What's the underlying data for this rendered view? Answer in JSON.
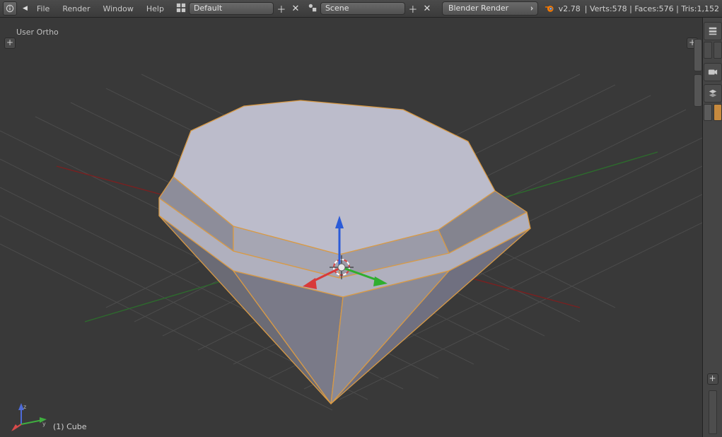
{
  "header": {
    "menus": [
      "File",
      "Render",
      "Window",
      "Help"
    ],
    "layout": "Default",
    "scene": "Scene",
    "render_engine": "Blender Render",
    "version": "v2.78",
    "stats": {
      "verts": 578,
      "faces": 576,
      "tris": 1152
    }
  },
  "viewport": {
    "view_label": "User Ortho",
    "object_label": "(1) Cube"
  },
  "icons": {
    "info": "info-icon",
    "layout_grip": "layout-grip-icon",
    "scene_grip": "scene-grip-icon",
    "plus": "+",
    "close": "✕"
  }
}
